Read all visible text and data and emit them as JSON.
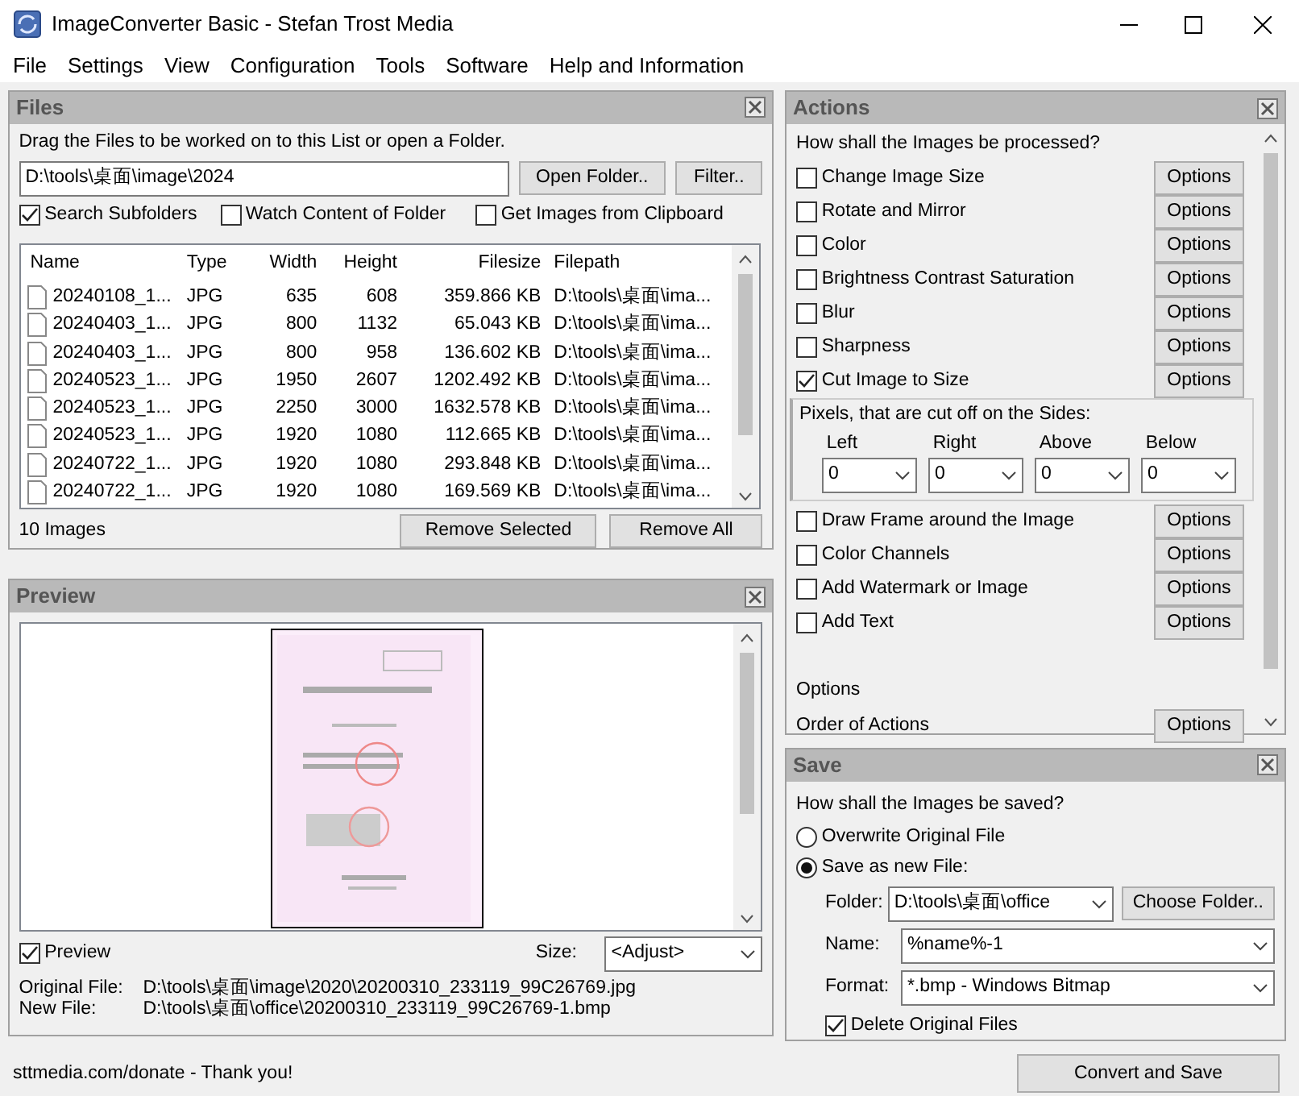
{
  "window": {
    "title": "ImageConverter Basic - Stefan Trost Media"
  },
  "menu": [
    "File",
    "Settings",
    "View",
    "Configuration",
    "Tools",
    "Software",
    "Help and Information"
  ],
  "files": {
    "title": "Files",
    "hint": "Drag the Files to be worked on to this List or open a Folder.",
    "path": "D:\\tools\\桌面\\image\\2024",
    "buttons": [
      "Open Folder..",
      "Filter.."
    ],
    "options": [
      {
        "label": "Search Subfolders",
        "checked": true
      },
      {
        "label": "Watch Content of Folder",
        "checked": false
      },
      {
        "label": "Get Images from Clipboard",
        "checked": false
      }
    ],
    "columns": [
      "Name",
      "Type",
      "Width",
      "Height",
      "Filesize",
      "Filepath"
    ],
    "rows": [
      [
        "20240108_1...",
        "JPG",
        "635",
        "608",
        "359.866 KB",
        "D:\\tools\\桌面\\ima..."
      ],
      [
        "20240403_1...",
        "JPG",
        "800",
        "1132",
        "65.043 KB",
        "D:\\tools\\桌面\\ima..."
      ],
      [
        "20240403_1...",
        "JPG",
        "800",
        "958",
        "136.602 KB",
        "D:\\tools\\桌面\\ima..."
      ],
      [
        "20240523_1...",
        "JPG",
        "1950",
        "2607",
        "1202.492 KB",
        "D:\\tools\\桌面\\ima..."
      ],
      [
        "20240523_1...",
        "JPG",
        "2250",
        "3000",
        "1632.578 KB",
        "D:\\tools\\桌面\\ima..."
      ],
      [
        "20240523_1...",
        "JPG",
        "1920",
        "1080",
        "112.665 KB",
        "D:\\tools\\桌面\\ima..."
      ],
      [
        "20240722_1...",
        "JPG",
        "1920",
        "1080",
        "293.848 KB",
        "D:\\tools\\桌面\\ima..."
      ],
      [
        "20240722_1...",
        "JPG",
        "1920",
        "1080",
        "169.569 KB",
        "D:\\tools\\桌面\\ima..."
      ]
    ],
    "count": "10 Images",
    "bottom_buttons": [
      "Remove Selected",
      "Remove All"
    ]
  },
  "preview": {
    "title": "Preview",
    "checkbox": {
      "label": "Preview",
      "checked": true
    },
    "size_label": "Size:",
    "size_value": "<Adjust>",
    "original_label": "Original File:",
    "original_value": "D:\\tools\\桌面\\image\\2020\\20200310_233119_99C26769.jpg",
    "new_label": "New File:",
    "new_value": "D:\\tools\\桌面\\office\\20200310_233119_99C26769-1.bmp"
  },
  "actions": {
    "title": "Actions",
    "question": "How shall the Images be processed?",
    "items": [
      {
        "label": "Change Image Size",
        "checked": false,
        "button": "Options"
      },
      {
        "label": "Rotate and Mirror",
        "checked": false,
        "button": "Options"
      },
      {
        "label": "Color",
        "checked": false,
        "button": "Options"
      },
      {
        "label": "Brightness Contrast Saturation",
        "checked": false,
        "button": "Options"
      },
      {
        "label": "Blur",
        "checked": false,
        "button": "Options"
      },
      {
        "label": "Sharpness",
        "checked": false,
        "button": "Options"
      },
      {
        "label": "Cut Image to Size",
        "checked": true,
        "button": "Options"
      }
    ],
    "cut": {
      "title": "Pixels, that are cut off on the Sides:",
      "fields": [
        {
          "label": "Left",
          "value": "0"
        },
        {
          "label": "Right",
          "value": "0"
        },
        {
          "label": "Above",
          "value": "0"
        },
        {
          "label": "Below",
          "value": "0"
        }
      ]
    },
    "items2": [
      {
        "label": "Draw Frame around the Image",
        "checked": false,
        "button": "Options"
      },
      {
        "label": "Color Channels",
        "checked": false,
        "button": "Options"
      },
      {
        "label": "Add Watermark or Image",
        "checked": false,
        "button": "Options"
      },
      {
        "label": "Add Text",
        "checked": false,
        "button": "Options"
      }
    ],
    "options_heading": "Options",
    "order_label": "Order of Actions",
    "order_button": "Options"
  },
  "save": {
    "title": "Save",
    "question": "How shall the Images be saved?",
    "modes": [
      {
        "label": "Overwrite Original File",
        "selected": false
      },
      {
        "label": "Save as new File:",
        "selected": true
      }
    ],
    "folder_label": "Folder:",
    "folder_value": "D:\\tools\\桌面\\office",
    "folder_button": "Choose Folder..",
    "name_label": "Name:",
    "name_value": "%name%-1",
    "format_label": "Format:",
    "format_value": "*.bmp - Windows Bitmap",
    "delete": {
      "label": "Delete Original Files",
      "checked": true
    }
  },
  "status_bar": "sttmedia.com/donate - Thank you!",
  "convert_button": "Convert and Save"
}
